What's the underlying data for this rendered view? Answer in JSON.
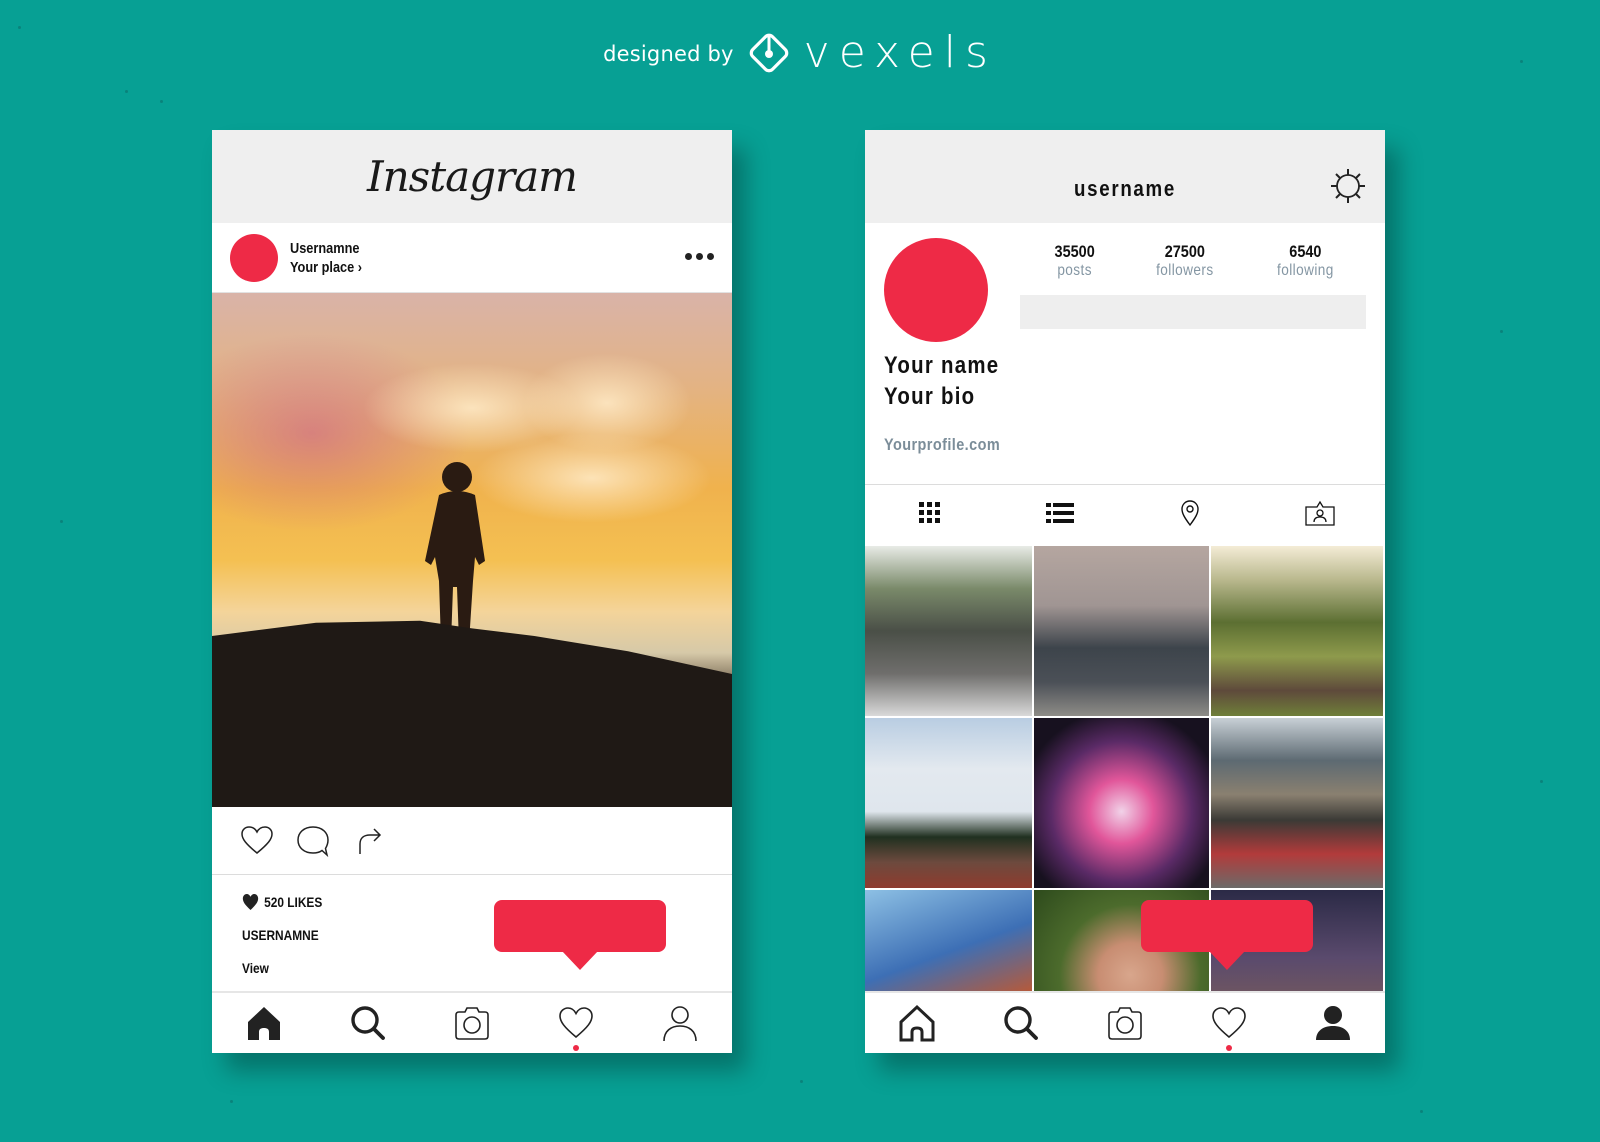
{
  "branding": {
    "prefix": "designed by",
    "name": "vexels"
  },
  "colors": {
    "background": "#07a094",
    "accent": "#ee2a46",
    "header_bg": "#efefef",
    "muted_text": "#8496a3"
  },
  "feed_screen": {
    "app_title": "Instagram",
    "post": {
      "username": "Usernamne",
      "location": "Your place",
      "location_chevron": "›",
      "more_icon": "more-horizontal-icon",
      "photo_description": "Silhouette of a man standing on a hill at sunset",
      "actions": [
        {
          "name": "like",
          "icon": "heart-outline-icon"
        },
        {
          "name": "comment",
          "icon": "comment-bubble-icon"
        },
        {
          "name": "share",
          "icon": "share-arrow-icon"
        }
      ],
      "likes_label": "520 LIKES",
      "caption_user": "USERNAMNE",
      "view_label": "View"
    },
    "notification_bubble": "",
    "bottom_nav": [
      {
        "name": "home",
        "icon": "home-filled-icon",
        "active": true
      },
      {
        "name": "search",
        "icon": "search-icon"
      },
      {
        "name": "camera",
        "icon": "camera-icon"
      },
      {
        "name": "activity",
        "icon": "heart-outline-icon",
        "badge_dot": true
      },
      {
        "name": "profile",
        "icon": "user-outline-icon"
      }
    ]
  },
  "profile_screen": {
    "username": "username",
    "settings_icon": "gear-icon",
    "stats": [
      {
        "value": "35500",
        "label": "posts"
      },
      {
        "value": "27500",
        "label": "followers"
      },
      {
        "value": "6540",
        "label": "following"
      }
    ],
    "name": "Your name",
    "bio": "Your bio",
    "website": "Yourprofile.com",
    "view_tabs": [
      {
        "name": "grid",
        "icon": "grid-icon"
      },
      {
        "name": "list",
        "icon": "list-icon"
      },
      {
        "name": "places",
        "icon": "location-pin-icon"
      },
      {
        "name": "tagged",
        "icon": "tagged-photo-icon"
      }
    ],
    "photos": [
      {
        "description": "Pedestrians crossing a city street"
      },
      {
        "description": "Person overlooking a hazy city skyline"
      },
      {
        "description": "People sitting on grass in a park at sunset"
      },
      {
        "description": "Confetti over a festival crowd"
      },
      {
        "description": "Concert stage with colorful smoke"
      },
      {
        "description": "City traffic jam in front of a tunnel"
      },
      {
        "description": "Person leaping across red rocks"
      },
      {
        "description": "Hands linked together over grass"
      },
      {
        "description": "Lone person under a starry night sky"
      }
    ],
    "notification_bubble": "",
    "bottom_nav": [
      {
        "name": "home",
        "icon": "home-outline-icon"
      },
      {
        "name": "search",
        "icon": "search-icon"
      },
      {
        "name": "camera",
        "icon": "camera-icon"
      },
      {
        "name": "activity",
        "icon": "heart-outline-icon",
        "badge_dot": true
      },
      {
        "name": "profile",
        "icon": "user-filled-icon",
        "active": true
      }
    ]
  }
}
